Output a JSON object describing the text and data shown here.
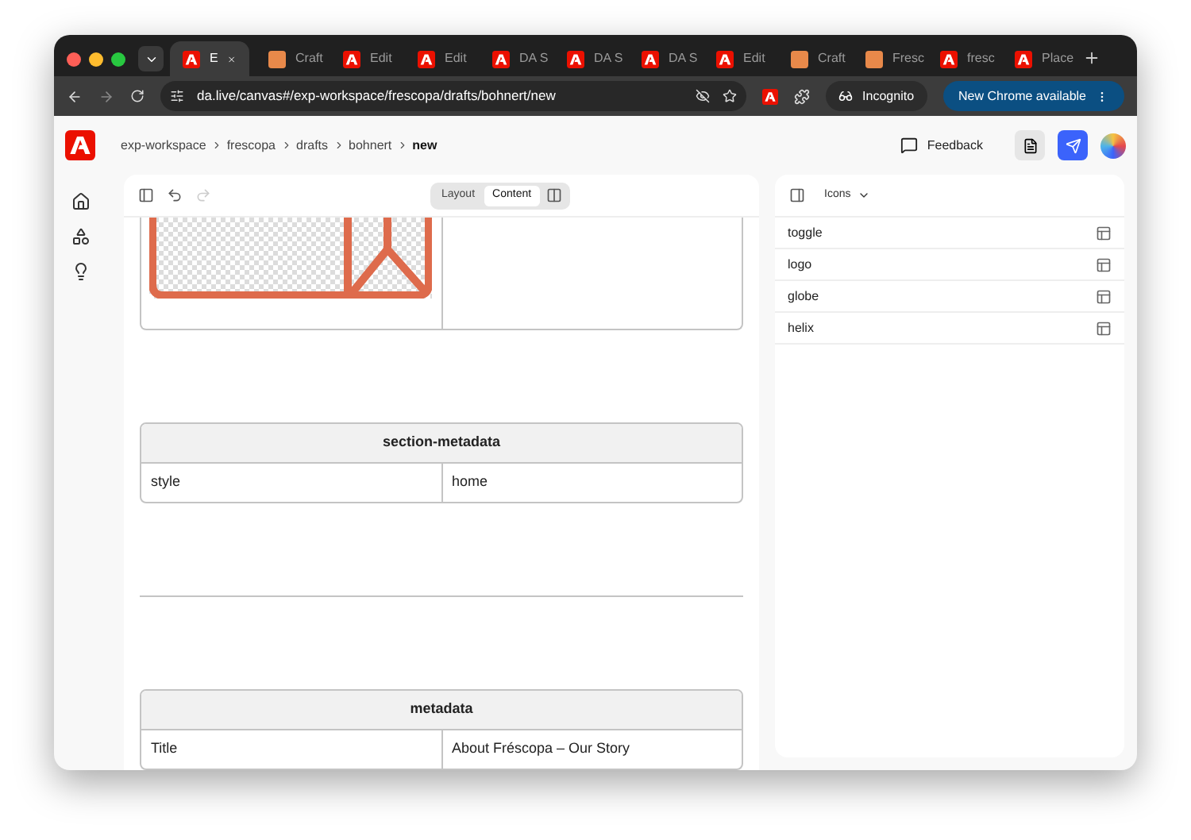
{
  "browser": {
    "tabs": [
      {
        "title": "E",
        "kind": "adobe",
        "selected": true
      },
      {
        "title": "Craft",
        "kind": "craft",
        "selected": false
      },
      {
        "title": "Edit",
        "kind": "adobe",
        "selected": false
      },
      {
        "title": "Edit",
        "kind": "adobe",
        "selected": false
      },
      {
        "title": "DA S",
        "kind": "adobe",
        "selected": false
      },
      {
        "title": "DA S",
        "kind": "adobe",
        "selected": false
      },
      {
        "title": "DA S",
        "kind": "adobe",
        "selected": false
      },
      {
        "title": "Edit",
        "kind": "adobe",
        "selected": false
      },
      {
        "title": "Craft",
        "kind": "craft",
        "selected": false
      },
      {
        "title": "Fresc",
        "kind": "craft",
        "selected": false
      },
      {
        "title": "fresc",
        "kind": "adobe",
        "selected": false
      },
      {
        "title": "Place",
        "kind": "adobe",
        "selected": false
      }
    ],
    "address": "da.live/canvas#/exp-workspace/frescopa/drafts/bohnert/new",
    "incognito": "Incognito",
    "update_button": "New Chrome available"
  },
  "app": {
    "breadcrumbs": [
      {
        "label": "exp-workspace",
        "current": false
      },
      {
        "label": "frescopa",
        "current": false
      },
      {
        "label": "drafts",
        "current": false
      },
      {
        "label": "bohnert",
        "current": false
      },
      {
        "label": "new",
        "current": true
      }
    ],
    "feedback": "Feedback"
  },
  "editor": {
    "view_toggle": [
      {
        "label": "Layout",
        "selected": false
      },
      {
        "label": "Content",
        "selected": true
      }
    ],
    "blocks": [
      {
        "kind": "image-table"
      },
      {
        "kind": "table",
        "title": "section-metadata",
        "rows": [
          [
            "style",
            "home"
          ]
        ]
      },
      {
        "kind": "divider"
      },
      {
        "kind": "table",
        "title": "metadata",
        "rows": [
          [
            "Title",
            "About Fréscopa – Our Story"
          ]
        ]
      }
    ]
  },
  "panel": {
    "dropdown": "Icons",
    "items": [
      "toggle",
      "logo",
      "globe",
      "helix"
    ]
  }
}
